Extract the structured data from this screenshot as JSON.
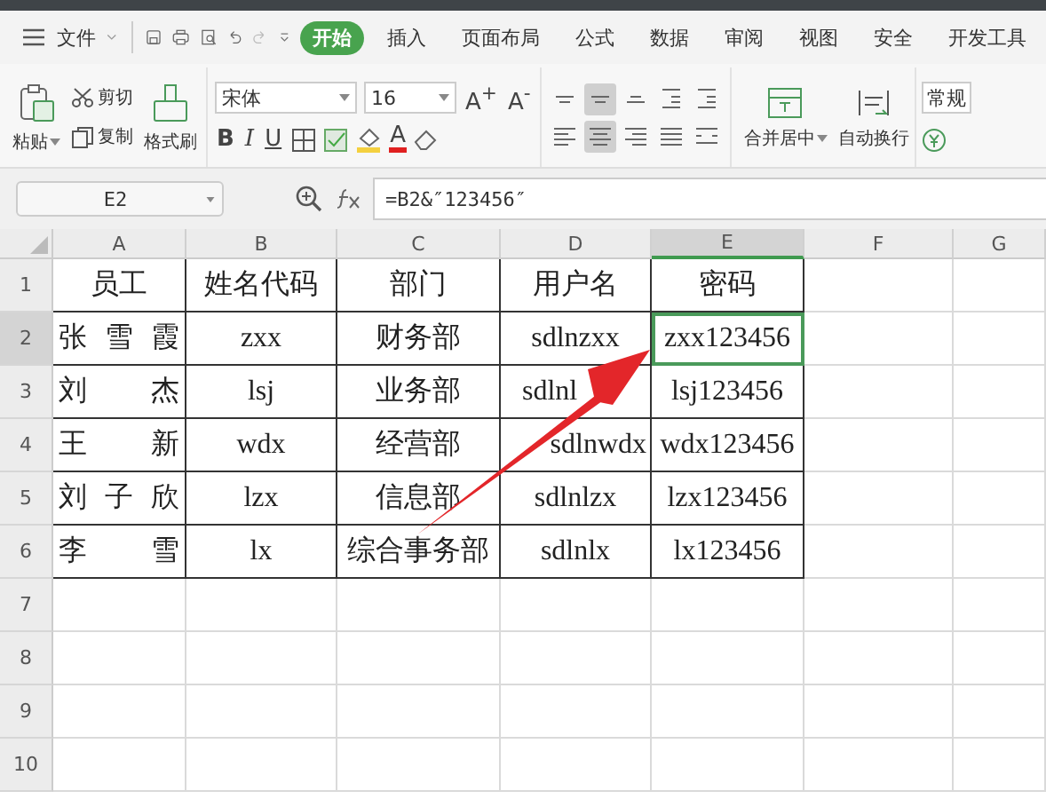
{
  "menu": {
    "file": "文件",
    "tabs": [
      {
        "label": "开始",
        "selected": true
      },
      {
        "label": "插入",
        "selected": false
      },
      {
        "label": "页面布局",
        "selected": false
      },
      {
        "label": "公式",
        "selected": false
      },
      {
        "label": "数据",
        "selected": false
      },
      {
        "label": "审阅",
        "selected": false
      },
      {
        "label": "视图",
        "selected": false
      },
      {
        "label": "安全",
        "selected": false
      },
      {
        "label": "开发工具",
        "selected": false
      }
    ]
  },
  "ribbon": {
    "paste": "粘贴",
    "cut": "剪切",
    "copy": "复制",
    "format_painter": "格式刷",
    "font": "宋体",
    "font_size": "16",
    "font_grow": "A$^{+}$",
    "font_shrink": "A$^{-}$",
    "bold": "B",
    "italic": "I",
    "underline": "U",
    "font_color": "A",
    "align_top": [
      {
        "kind": "top",
        "selected": false
      },
      {
        "kind": "middle",
        "selected": true
      },
      {
        "kind": "bottom",
        "selected": false
      },
      {
        "kind": "outdent",
        "selected": false
      },
      {
        "kind": "indent",
        "selected": false
      }
    ],
    "align_bottom": [
      {
        "kind": "left",
        "selected": false
      },
      {
        "kind": "center",
        "selected": true
      },
      {
        "kind": "right",
        "selected": false
      },
      {
        "kind": "justify",
        "selected": false
      },
      {
        "kind": "distribute",
        "selected": false
      }
    ],
    "merge": "合并居中",
    "wrap": "自动换行",
    "number_format": "常规"
  },
  "formula_bar": {
    "cell": "E2",
    "formula": "=B2&″123456″"
  },
  "sheet": {
    "columns": [
      {
        "label": "A",
        "selected": false
      },
      {
        "label": "B",
        "selected": false
      },
      {
        "label": "C",
        "selected": false
      },
      {
        "label": "D",
        "selected": false
      },
      {
        "label": "E",
        "selected": true
      },
      {
        "label": "F",
        "selected": false
      },
      {
        "label": "G",
        "selected": false
      }
    ],
    "rows": [
      {
        "label": "1",
        "selected": false,
        "cells": [
          {
            "text": "员工",
            "kind": "center"
          },
          {
            "text": "姓名代码",
            "kind": "center"
          },
          {
            "text": "部门",
            "kind": "center"
          },
          {
            "text": "用户名",
            "kind": "center"
          },
          {
            "text": "密码",
            "kind": "center"
          }
        ]
      },
      {
        "label": "2",
        "selected": true,
        "cells": [
          {
            "text": "张 雪 霞",
            "kind": "spread"
          },
          {
            "text": "zxx",
            "kind": "center"
          },
          {
            "text": "财务部",
            "kind": "center"
          },
          {
            "text": "sdlnzxx",
            "kind": "center"
          },
          {
            "text": "zxx123456",
            "kind": "center"
          }
        ]
      },
      {
        "label": "3",
        "selected": false,
        "cells": [
          {
            "text": "刘 杰",
            "kind": "spread"
          },
          {
            "text": "lsj",
            "kind": "center"
          },
          {
            "text": "业务部",
            "kind": "center"
          },
          {
            "text": "sdlnl",
            "kind": "left"
          },
          {
            "text": "lsj123456",
            "kind": "center"
          }
        ]
      },
      {
        "label": "4",
        "selected": false,
        "cells": [
          {
            "text": "王 新",
            "kind": "spread"
          },
          {
            "text": "wdx",
            "kind": "center"
          },
          {
            "text": "经营部",
            "kind": "center"
          },
          {
            "text": "sdlnwdx",
            "kind": "right"
          },
          {
            "text": "wdx123456",
            "kind": "center"
          }
        ]
      },
      {
        "label": "5",
        "selected": false,
        "cells": [
          {
            "text": "刘 子 欣",
            "kind": "spread"
          },
          {
            "text": "lzx",
            "kind": "center"
          },
          {
            "text": "信息部",
            "kind": "center"
          },
          {
            "text": "sdlnlzx",
            "kind": "center"
          },
          {
            "text": "lzx123456",
            "kind": "center"
          }
        ]
      },
      {
        "label": "6",
        "selected": false,
        "cells": [
          {
            "text": "李 雪",
            "kind": "spread"
          },
          {
            "text": "lx",
            "kind": "center"
          },
          {
            "text": "综合事务部",
            "kind": "center"
          },
          {
            "text": "sdlnlx",
            "kind": "center"
          },
          {
            "text": "lx123456",
            "kind": "center"
          }
        ]
      },
      {
        "label": "7",
        "selected": false,
        "cells": []
      },
      {
        "label": "8",
        "selected": false,
        "cells": []
      },
      {
        "label": "9",
        "selected": false,
        "cells": []
      },
      {
        "label": "10",
        "selected": false,
        "cells": []
      }
    ]
  }
}
